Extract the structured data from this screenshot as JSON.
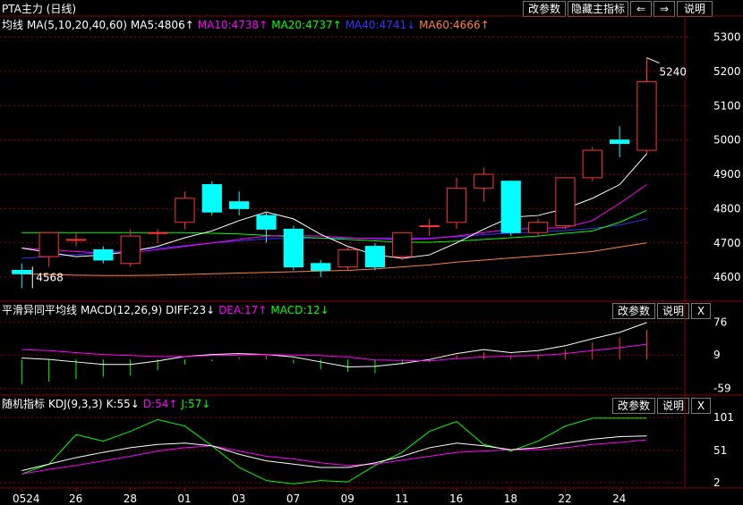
{
  "title": "PTA主力 (日线)",
  "toolbar": {
    "params_label": "改参数",
    "hide_indicator_label": "隐藏主指标",
    "help_label": "说明",
    "prev_glyph": "⇐",
    "next_glyph": "⇒"
  },
  "ma_panel": {
    "legend": {
      "label": "均线",
      "ma_params": "MA(5,10,20,40,60)",
      "ma5": "MA5:4806↑",
      "ma10": "MA10:4738↑",
      "ma20": "MA20:4737↑",
      "ma40": "MA40:4741↓",
      "ma60": "MA60:4666↑"
    },
    "y_ticks": [
      "5300",
      "5200",
      "5100",
      "5000",
      "4900",
      "4800",
      "4700",
      "4600"
    ],
    "high_marker": "5240",
    "low_marker": "4568"
  },
  "macd_panel": {
    "legend": {
      "name": "平滑异同平均线",
      "params": "MACD(12,26,9)",
      "diff": "DIFF:23↓",
      "dea": "DEA:17↑",
      "macd": "MACD:12↓"
    },
    "params_label": "改参数",
    "help_label": "说明",
    "close_label": "X",
    "y_ticks": [
      "76",
      "9",
      "-59"
    ]
  },
  "kdj_panel": {
    "legend": {
      "name": "随机指标",
      "params": "KDJ(9,3,3)",
      "k": "K:55↓",
      "d": "D:54↑",
      "j": "J:57↓"
    },
    "params_label": "改参数",
    "help_label": "说明",
    "close_label": "X",
    "y_ticks": [
      "101",
      "51",
      "2"
    ]
  },
  "x_axis": [
    "0524",
    "26",
    "28",
    "01",
    "03",
    "07",
    "09",
    "11",
    "16",
    "18",
    "22",
    "24"
  ],
  "colors": {
    "up": "#ff3333",
    "down": "#00ffff",
    "ma5": "#ffffff",
    "ma10": "#ff00ff",
    "ma20": "#00ff00",
    "ma40": "#3333ff",
    "ma60": "#ff8040",
    "grid": "#8b0000"
  },
  "chart_data": {
    "type": "candlestick",
    "candles": [
      {
        "o": 4620,
        "h": 4640,
        "l": 4568,
        "c": 4610
      },
      {
        "o": 4660,
        "h": 4730,
        "l": 4630,
        "c": 4730
      },
      {
        "o": 4710,
        "h": 4730,
        "l": 4690,
        "c": 4710
      },
      {
        "o": 4680,
        "h": 4690,
        "l": 4640,
        "c": 4650
      },
      {
        "o": 4640,
        "h": 4740,
        "l": 4630,
        "c": 4720
      },
      {
        "o": 4730,
        "h": 4740,
        "l": 4700,
        "c": 4730
      },
      {
        "o": 4760,
        "h": 4850,
        "l": 4740,
        "c": 4830
      },
      {
        "o": 4870,
        "h": 4880,
        "l": 4780,
        "c": 4790
      },
      {
        "o": 4820,
        "h": 4850,
        "l": 4780,
        "c": 4800
      },
      {
        "o": 4780,
        "h": 4790,
        "l": 4700,
        "c": 4740
      },
      {
        "o": 4740,
        "h": 4750,
        "l": 4620,
        "c": 4630
      },
      {
        "o": 4640,
        "h": 4650,
        "l": 4600,
        "c": 4620
      },
      {
        "o": 4630,
        "h": 4690,
        "l": 4620,
        "c": 4680
      },
      {
        "o": 4690,
        "h": 4700,
        "l": 4620,
        "c": 4630
      },
      {
        "o": 4660,
        "h": 4730,
        "l": 4650,
        "c": 4730
      },
      {
        "o": 4750,
        "h": 4770,
        "l": 4720,
        "c": 4750
      },
      {
        "o": 4760,
        "h": 4890,
        "l": 4740,
        "c": 4860
      },
      {
        "o": 4860,
        "h": 4920,
        "l": 4820,
        "c": 4900
      },
      {
        "o": 4880,
        "h": 4880,
        "l": 4720,
        "c": 4730
      },
      {
        "o": 4730,
        "h": 4770,
        "l": 4720,
        "c": 4760
      },
      {
        "o": 4750,
        "h": 4890,
        "l": 4740,
        "c": 4890
      },
      {
        "o": 4890,
        "h": 4980,
        "l": 4880,
        "c": 4970
      },
      {
        "o": 5000,
        "h": 5040,
        "l": 4950,
        "c": 4990
      },
      {
        "o": 4970,
        "h": 5240,
        "l": 4960,
        "c": 5170
      }
    ],
    "ma5": [
      4685,
      4672,
      4660,
      4665,
      4675,
      4690,
      4715,
      4735,
      4765,
      4790,
      4770,
      4725,
      4690,
      4665,
      4655,
      4665,
      4700,
      4740,
      4775,
      4780,
      4800,
      4830,
      4870,
      4960
    ],
    "ma10": [
      4685,
      4680,
      4675,
      4670,
      4672,
      4680,
      4690,
      4700,
      4710,
      4720,
      4722,
      4720,
      4715,
      4712,
      4710,
      4712,
      4720,
      4730,
      4740,
      4742,
      4745,
      4765,
      4815,
      4870
    ],
    "ma20": [
      4730,
      4730,
      4730,
      4730,
      4730,
      4730,
      4730,
      4728,
      4726,
      4722,
      4718,
      4714,
      4710,
      4706,
      4702,
      4702,
      4705,
      4710,
      4715,
      4720,
      4728,
      4735,
      4760,
      4795
    ],
    "ma40": [
      4655,
      4660,
      4666,
      4672,
      4678,
      4684,
      4692,
      4700,
      4706,
      4712,
      4714,
      4714,
      4714,
      4714,
      4714,
      4714,
      4718,
      4724,
      4728,
      4732,
      4736,
      4742,
      4752,
      4770
    ],
    "ma60": [
      4610,
      4608,
      4606,
      4605,
      4605,
      4606,
      4608,
      4610,
      4612,
      4614,
      4616,
      4618,
      4620,
      4624,
      4630,
      4636,
      4644,
      4650,
      4656,
      4662,
      4668,
      4675,
      4688,
      4700
    ],
    "ylim": [
      4530,
      5330
    ],
    "macd": {
      "diff": [
        3,
        0,
        -5,
        -10,
        -10,
        -3,
        6,
        10,
        12,
        10,
        5,
        -5,
        -15,
        -14,
        -8,
        0,
        12,
        20,
        14,
        18,
        28,
        42,
        55,
        75
      ],
      "dea": [
        20,
        18,
        14,
        10,
        8,
        6,
        6,
        8,
        9,
        10,
        9,
        8,
        5,
        -1,
        -2,
        -3,
        2,
        5,
        7,
        8,
        12,
        18,
        24,
        31
      ],
      "bars": [
        -50,
        -45,
        -40,
        -35,
        -33,
        -22,
        -10,
        -4,
        5,
        8,
        -8,
        -20,
        -25,
        -28,
        -10,
        -5,
        8,
        15,
        8,
        10,
        20,
        35,
        45,
        60
      ],
      "ylim": [
        -65,
        82
      ]
    },
    "kdj": {
      "k": [
        20,
        30,
        40,
        48,
        55,
        60,
        62,
        58,
        45,
        35,
        30,
        25,
        25,
        32,
        42,
        55,
        62,
        58,
        52,
        55,
        62,
        68,
        72,
        73
      ],
      "d": [
        15,
        22,
        28,
        35,
        42,
        50,
        55,
        58,
        50,
        42,
        38,
        32,
        28,
        30,
        36,
        42,
        48,
        50,
        52,
        52,
        55,
        60,
        63,
        67
      ],
      "j": [
        15,
        30,
        75,
        65,
        80,
        98,
        88,
        58,
        25,
        5,
        0,
        5,
        3,
        28,
        48,
        80,
        95,
        60,
        50,
        65,
        88,
        100,
        100,
        100
      ],
      "ylim": [
        -5,
        108
      ]
    }
  }
}
